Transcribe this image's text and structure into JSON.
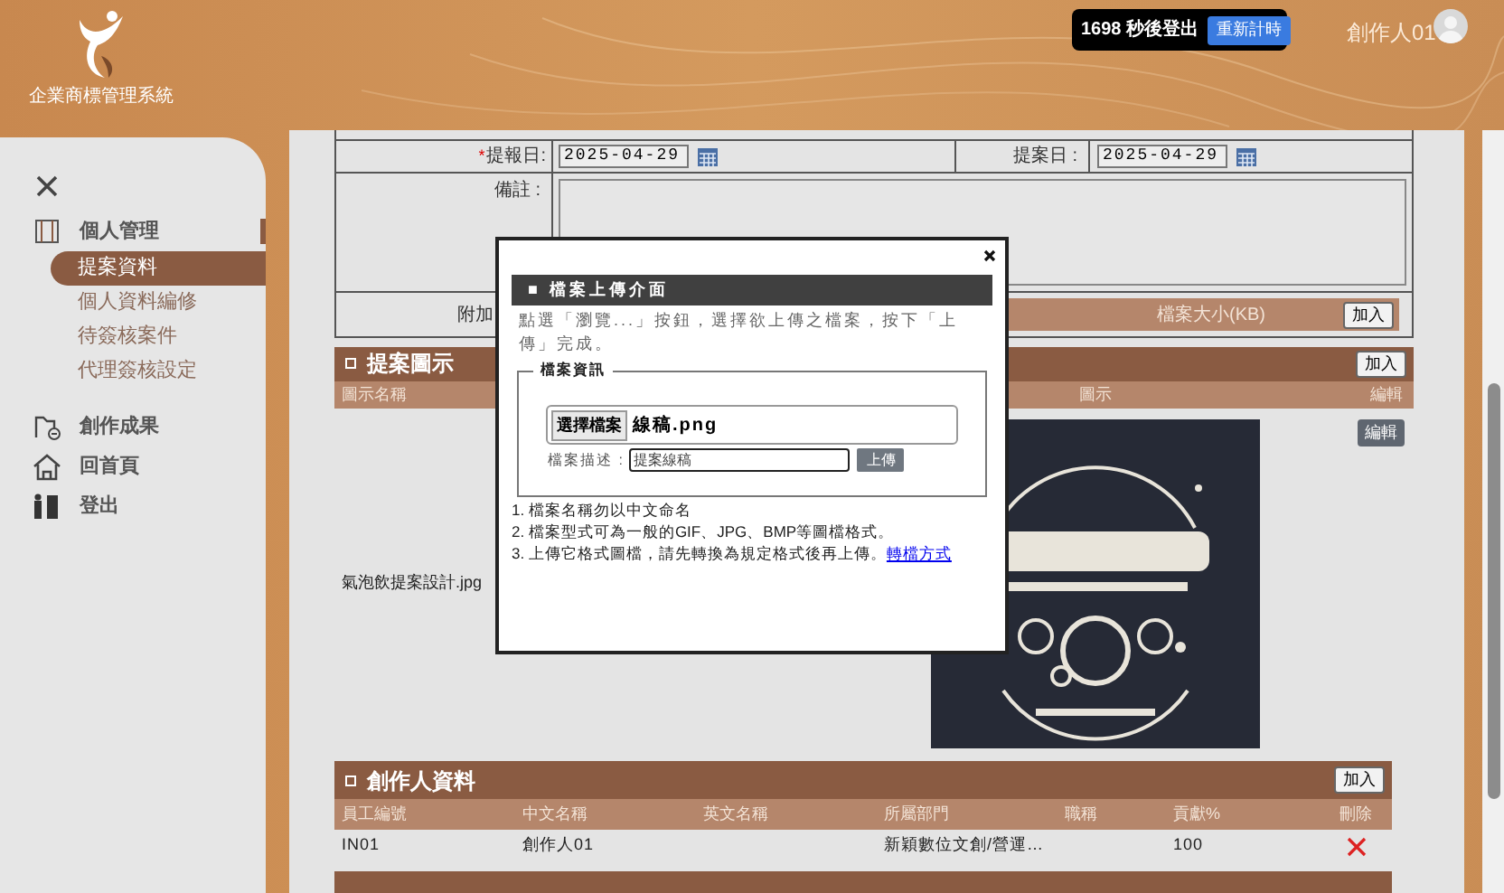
{
  "header": {
    "system_name": "企業商標管理系統",
    "countdown": "1698 秒後登出",
    "reset_button": "重新計時",
    "user": "創作人01"
  },
  "sidebar": {
    "items": [
      {
        "label": "個人管理",
        "expanded": true,
        "children": [
          {
            "label": "提案資料",
            "selected": true
          },
          {
            "label": "個人資料編修",
            "selected": false
          },
          {
            "label": "待簽核案件",
            "selected": false
          },
          {
            "label": "代理簽核設定",
            "selected": false
          }
        ]
      },
      {
        "label": "創作成果"
      },
      {
        "label": "回首頁"
      },
      {
        "label": "登出"
      }
    ]
  },
  "form": {
    "report_date": {
      "required_mark": "*",
      "label": "提報日:",
      "value": "2025-04-29"
    },
    "proposal_date": {
      "label": "提案日 :",
      "value": "2025-04-29"
    },
    "remarks": {
      "label": "備註 :"
    },
    "attachment": {
      "label": "附加",
      "size_column": "檔案大小(KB)",
      "add_button": "加入"
    }
  },
  "icon_section": {
    "title": "提案圖示",
    "add_button": "加入",
    "columns": [
      "圖示名稱",
      "圖示",
      "編輯"
    ],
    "rows": [
      {
        "name": "氣泡飲提案設計.jpg",
        "edit_button": "編輯"
      }
    ]
  },
  "creator_section": {
    "title": "創作人資料",
    "add_button": "加入",
    "columns": [
      "員工編號",
      "中文名稱",
      "英文名稱",
      "所屬部門",
      "職稱",
      "貢獻%",
      "刪除"
    ],
    "rows": [
      {
        "employee_id": "IN01",
        "name_zh": "創作人01",
        "department": "新穎數位文創/營運…",
        "contribution": "100"
      }
    ]
  },
  "upload_dialog": {
    "title": "■ 檔案上傳介面",
    "instruction": "點選「瀏覽...」按鈕，選擇欲上傳之檔案，按下「上傳」完成。",
    "legend": "檔案資訊",
    "file_button": "選擇檔案",
    "file_name": "線稿.png",
    "description_label": "檔案描述 :",
    "description_value": "提案線稿",
    "upload_button": "上傳",
    "notes": [
      {
        "text": "1. 檔案名稱勿以中文命名"
      },
      {
        "text": "2. 檔案型式可為一般的GIF、JPG、BMP等圖檔格式。"
      },
      {
        "text": "3. 上傳它格式圖檔，請先轉換為規定格式後再上傳。",
        "link": "轉檔方式"
      }
    ]
  }
}
